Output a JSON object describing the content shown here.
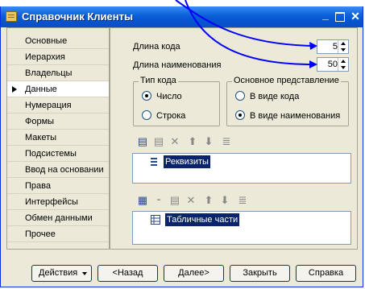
{
  "window": {
    "title": "Справочник Клиенты"
  },
  "sidebar": {
    "items": [
      {
        "label": "Основные"
      },
      {
        "label": "Иерархия"
      },
      {
        "label": "Владельцы"
      },
      {
        "label": "Данные"
      },
      {
        "label": "Нумерация"
      },
      {
        "label": "Формы"
      },
      {
        "label": "Макеты"
      },
      {
        "label": "Подсистемы"
      },
      {
        "label": "Ввод на основании"
      },
      {
        "label": "Права"
      },
      {
        "label": "Интерфейсы"
      },
      {
        "label": "Обмен данными"
      },
      {
        "label": "Прочее"
      }
    ],
    "active_index": 3
  },
  "data": {
    "code_length_label": "Длина кода",
    "code_length_value": "5",
    "name_length_label": "Длина наименования",
    "name_length_value": "50",
    "code_type": {
      "title": "Тип кода",
      "options": [
        "Число",
        "Строка"
      ],
      "selected": "Число"
    },
    "main_repr": {
      "title": "Основное представление",
      "options": [
        "В виде кода",
        "В виде наименования"
      ],
      "selected": "В виде наименования"
    },
    "attributes_list": {
      "items": [
        "Реквизиты"
      ]
    },
    "tabular_list": {
      "items": [
        "Табличные части"
      ]
    }
  },
  "toolbar1": {
    "icons": [
      "add-item-icon",
      "edit-item-icon",
      "delete-item-icon",
      "move-up-icon",
      "move-down-icon",
      "sort-icon"
    ]
  },
  "toolbar2": {
    "icons": [
      "add-table-icon",
      "add-attribute-icon",
      "edit-item-icon",
      "delete-item-icon",
      "move-up-icon",
      "move-down-icon",
      "sort-icon"
    ]
  },
  "buttons": {
    "actions": "Действия",
    "back": "<Назад",
    "next": "Далее>",
    "close": "Закрыть",
    "help": "Справка"
  },
  "colors": {
    "titlebar": "#0a5fd8",
    "selection": "#0a246a",
    "annotation_arrows": "#0000ff"
  }
}
